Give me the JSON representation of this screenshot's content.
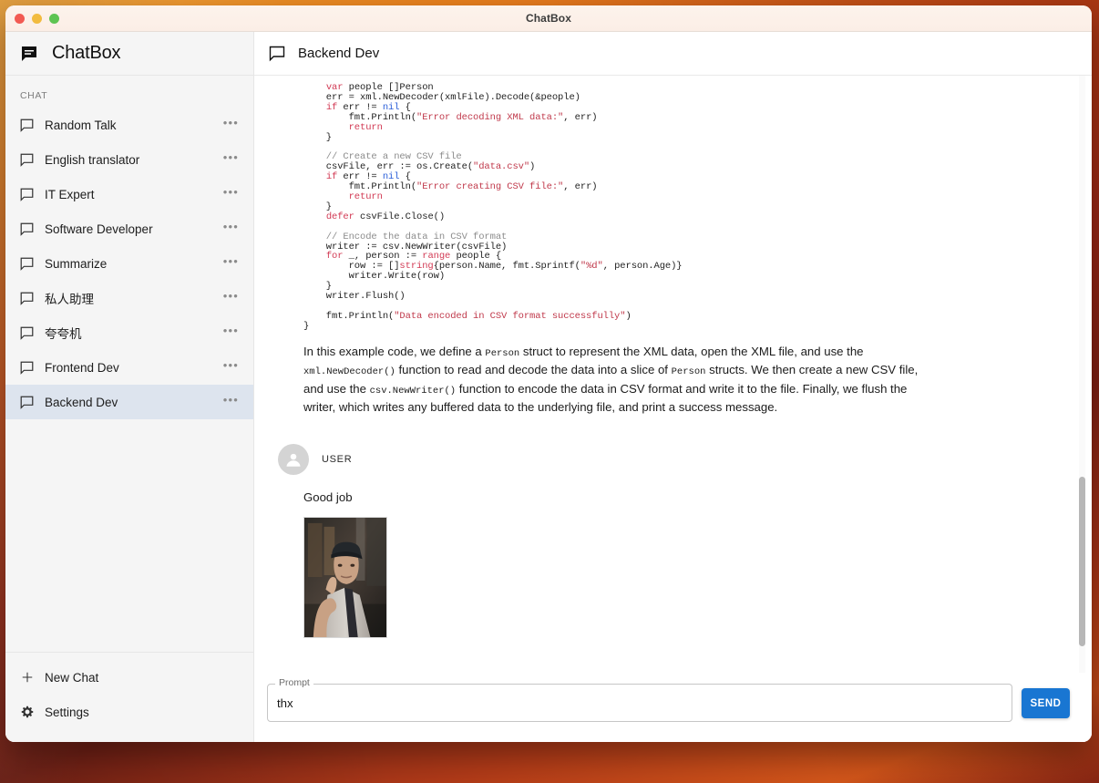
{
  "window": {
    "title": "ChatBox",
    "traffic_lights": [
      "close-red",
      "minimize-yellow",
      "maximize-green"
    ]
  },
  "sidebar": {
    "brand": "ChatBox",
    "brand_icon": "chat-bubble-filled-icon",
    "section_label": "CHAT",
    "items": [
      {
        "label": "Random Talk",
        "icon": "chat-bubble-outline-icon",
        "menu": "•••",
        "selected": false
      },
      {
        "label": "English translator",
        "icon": "chat-bubble-outline-icon",
        "menu": "•••",
        "selected": false
      },
      {
        "label": "IT Expert",
        "icon": "chat-bubble-outline-icon",
        "menu": "•••",
        "selected": false
      },
      {
        "label": "Software Developer",
        "icon": "chat-bubble-outline-icon",
        "menu": "•••",
        "selected": false
      },
      {
        "label": "Summarize",
        "icon": "chat-bubble-outline-icon",
        "menu": "•••",
        "selected": false
      },
      {
        "label": "私人助理",
        "icon": "chat-bubble-outline-icon",
        "menu": "•••",
        "selected": false
      },
      {
        "label": "夸夸机",
        "icon": "chat-bubble-outline-icon",
        "menu": "•••",
        "selected": false
      },
      {
        "label": "Frontend Dev",
        "icon": "chat-bubble-outline-icon",
        "menu": "•••",
        "selected": false
      },
      {
        "label": "Backend Dev",
        "icon": "chat-bubble-outline-icon",
        "menu": "•••",
        "selected": true
      }
    ],
    "new_chat": {
      "label": "New Chat",
      "icon": "plus-icon"
    },
    "settings": {
      "label": "Settings",
      "icon": "gear-icon"
    }
  },
  "main": {
    "header": {
      "title": "Backend Dev",
      "icon": "chat-bubble-outline-icon"
    },
    "assistant_message": {
      "code_lines": [
        "    var people []Person",
        "    err = xml.NewDecoder(xmlFile).Decode(&people)",
        "    if err != nil {",
        "        fmt.Println(\"Error decoding XML data:\", err)",
        "        return",
        "    }",
        "",
        "    // Create a new CSV file",
        "    csvFile, err := os.Create(\"data.csv\")",
        "    if err != nil {",
        "        fmt.Println(\"Error creating CSV file:\", err)",
        "        return",
        "    }",
        "    defer csvFile.Close()",
        "",
        "    // Encode the data in CSV format",
        "    writer := csv.NewWriter(csvFile)",
        "    for _, person := range people {",
        "        row := []string{person.Name, fmt.Sprintf(\"%d\", person.Age)}",
        "        writer.Write(row)",
        "    }",
        "    writer.Flush()",
        "",
        "    fmt.Println(\"Data encoded in CSV format successfully\")",
        "}"
      ],
      "paragraph_parts": [
        {
          "type": "text",
          "value": "In this example code, we define a "
        },
        {
          "type": "code",
          "value": "Person"
        },
        {
          "type": "text",
          "value": " struct to represent the XML data, open the XML file, and use the "
        },
        {
          "type": "code",
          "value": "xml.NewDecoder()"
        },
        {
          "type": "text",
          "value": " function to read and decode the data into a slice of "
        },
        {
          "type": "code",
          "value": "Person"
        },
        {
          "type": "text",
          "value": " structs. We then create a new CSV file, and use the "
        },
        {
          "type": "code",
          "value": "csv.NewWriter()"
        },
        {
          "type": "text",
          "value": " function to encode the data in CSV format and write it to the file. Finally, we flush the writer, which writes any buffered data to the underlying file, and print a success message."
        }
      ]
    },
    "user_message": {
      "role": "USER",
      "avatar_icon": "person-icon",
      "text": "Good job",
      "attachment": {
        "alt": "photo-elderly-man-thumbs-up"
      }
    }
  },
  "composer": {
    "field_label": "Prompt",
    "field_value": "thx",
    "field_placeholder": "Prompt",
    "send_label": "SEND",
    "send_color": "#1976d2"
  }
}
